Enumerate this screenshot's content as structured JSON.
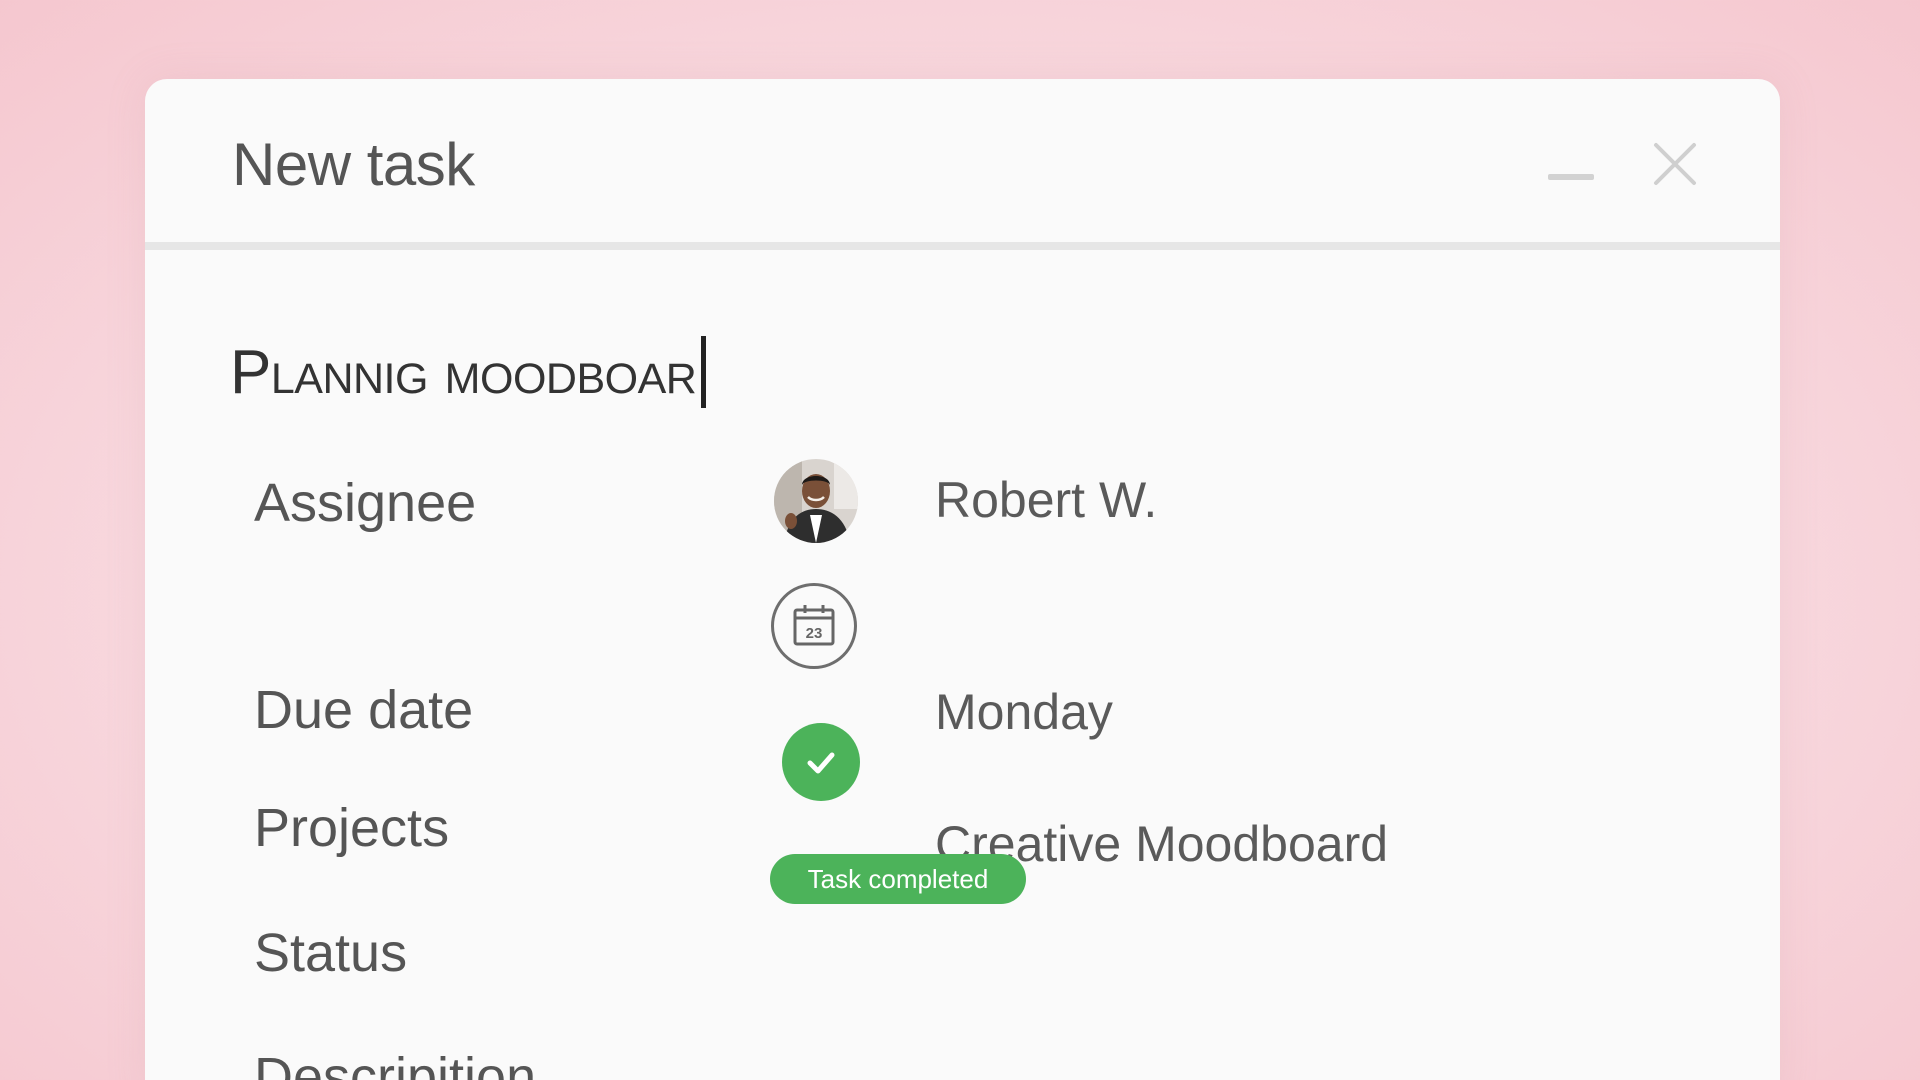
{
  "dialog": {
    "title": "New task",
    "minimize_icon": "minimize-icon",
    "close_icon": "close-icon"
  },
  "task": {
    "name": "Plannig moodboar"
  },
  "fields": {
    "assignee": {
      "label": "Assignee",
      "value": "Robert W.",
      "icon": "avatar"
    },
    "due_date": {
      "label": "Due date",
      "value": "Monday",
      "icon": "calendar-icon",
      "icon_day": "23"
    },
    "projects": {
      "label": "Projects",
      "value": "Creative Moodboard",
      "icon": "check-icon"
    },
    "status": {
      "label": "Status",
      "badge": "Task completed"
    },
    "description": {
      "label": "Descripition"
    }
  },
  "colors": {
    "accent_green": "#4cb35a",
    "background_pink": "#f8d9df"
  }
}
